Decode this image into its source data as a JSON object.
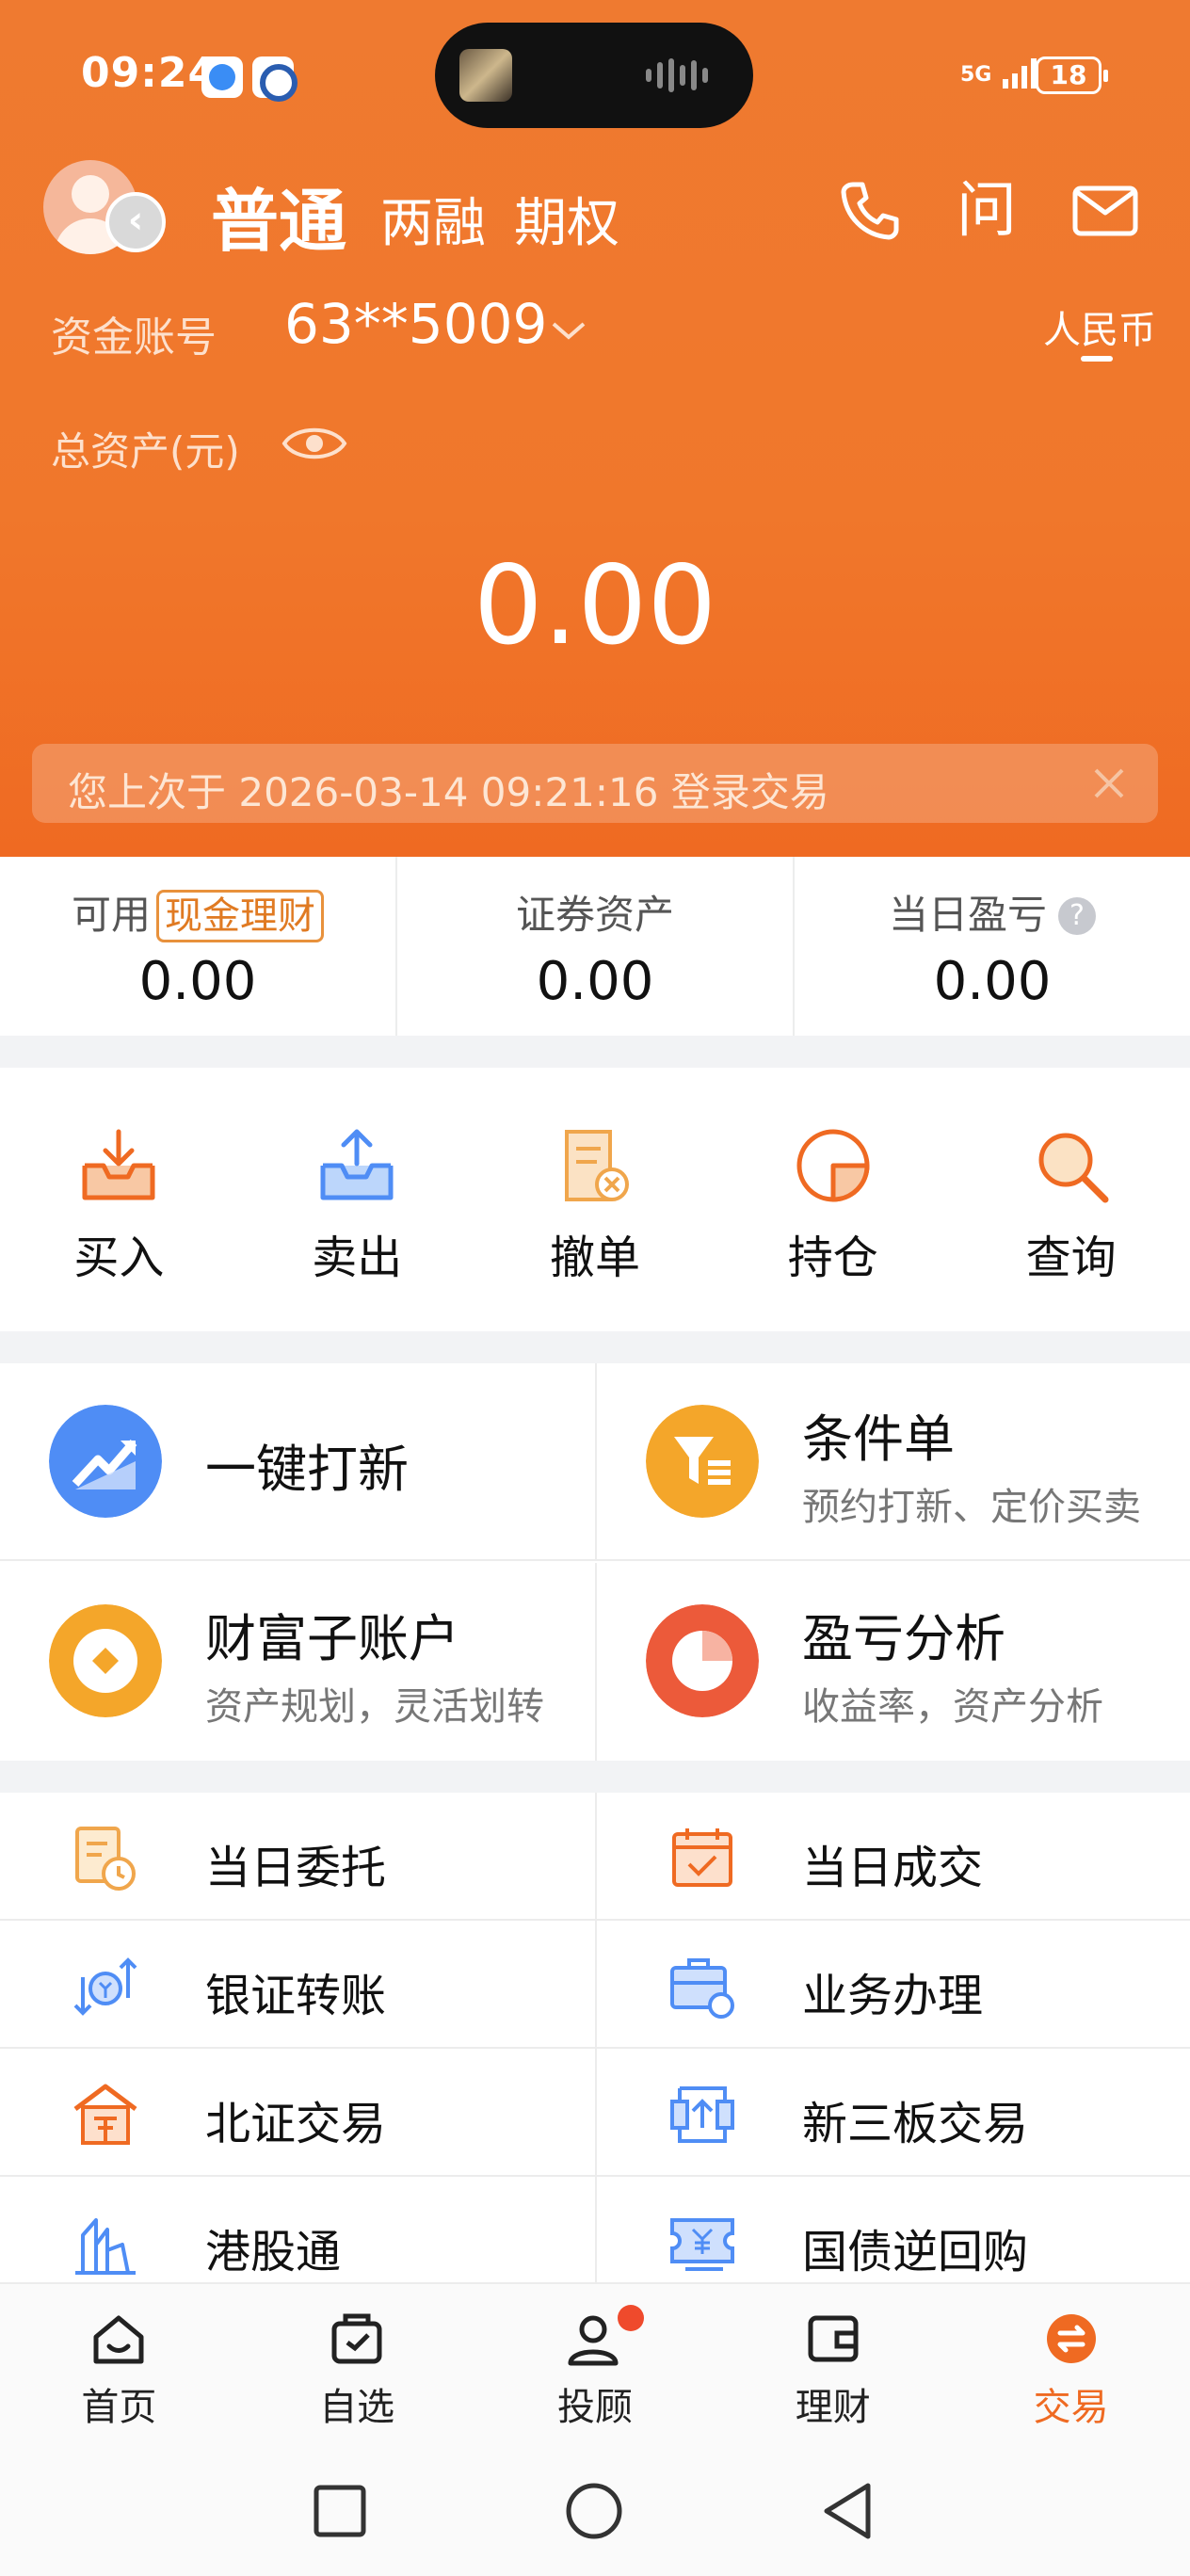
{
  "status_bar": {
    "time": "09:24",
    "network": "5G",
    "battery": "18"
  },
  "header": {
    "account_type": "普通",
    "account_options": [
      "两融",
      "期权"
    ],
    "ask_label": "问",
    "fund_account_label": "资金账号",
    "fund_account_number": "63**5009",
    "currency": "人民币",
    "total_assets_label": "总资产(元)",
    "total_assets_value": "0.00",
    "last_login_text": "您上次于 2026-03-14  09:21:16 登录交易"
  },
  "stats": [
    {
      "label": "可用",
      "tag": "现金理财",
      "value": "0.00"
    },
    {
      "label": "证券资产",
      "value": "0.00"
    },
    {
      "label": "当日盈亏",
      "help": "?",
      "value": "0.00"
    }
  ],
  "quick_actions": [
    {
      "label": "买入",
      "icon": "buy-tray-icon"
    },
    {
      "label": "卖出",
      "icon": "sell-tray-icon"
    },
    {
      "label": "撤单",
      "icon": "cancel-order-icon"
    },
    {
      "label": "持仓",
      "icon": "holdings-pie-icon"
    },
    {
      "label": "查询",
      "icon": "search-icon"
    }
  ],
  "features": [
    {
      "title": "一键打新",
      "subtitle": "",
      "icon": "ipo-icon",
      "color": "#4f8df5"
    },
    {
      "title": "条件单",
      "subtitle": "预约打新、定价买卖",
      "icon": "funnel-icon",
      "color": "#f4a62a"
    },
    {
      "title": "财富子账户",
      "subtitle": "资产规划，灵活划转",
      "icon": "coin-icon",
      "color": "#f4a62a"
    },
    {
      "title": "盈亏分析",
      "subtitle": "收益率，资产分析",
      "icon": "pie-chart-icon",
      "color": "#ec5a3a"
    }
  ],
  "menu": [
    {
      "label": "当日委托",
      "icon": "order-clock-icon"
    },
    {
      "label": "当日成交",
      "icon": "calendar-check-icon"
    },
    {
      "label": "银证转账",
      "icon": "transfer-icon"
    },
    {
      "label": "业务办理",
      "icon": "briefcase-icon"
    },
    {
      "label": "北证交易",
      "icon": "beijing-house-icon"
    },
    {
      "label": "新三板交易",
      "icon": "upload-board-icon"
    },
    {
      "label": "港股通",
      "icon": "hk-building-icon"
    },
    {
      "label": "国债逆回购",
      "icon": "bond-ticket-icon"
    }
  ],
  "tabs": [
    {
      "label": "首页",
      "icon": "home-icon"
    },
    {
      "label": "自选",
      "icon": "watchlist-icon"
    },
    {
      "label": "投顾",
      "icon": "advisor-icon"
    },
    {
      "label": "理财",
      "icon": "wallet-icon"
    },
    {
      "label": "交易",
      "icon": "trade-icon",
      "active": true
    }
  ],
  "colors": {
    "brand": "#ef7a30",
    "accent": "#ef6a22",
    "blue_icon": "#4f8df5"
  }
}
